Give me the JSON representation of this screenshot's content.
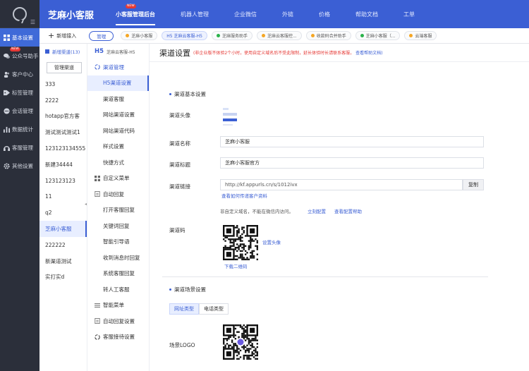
{
  "app": {
    "brand": "芝麻小客服",
    "nav_new_badge": "NEW"
  },
  "topnav": {
    "items": [
      {
        "label": "小客服管理后台",
        "active": true
      },
      {
        "label": "机器人管理"
      },
      {
        "label": "企业微信"
      },
      {
        "label": "外链"
      },
      {
        "label": "价格"
      },
      {
        "label": "帮助文档"
      },
      {
        "label": "工单"
      }
    ]
  },
  "sidebar": {
    "new_badge": "NEW",
    "items": [
      {
        "label": "基本设置",
        "icon": "grid-icon",
        "active": true
      },
      {
        "label": "公众号助手",
        "icon": "wechat-icon"
      },
      {
        "label": "客户中心",
        "icon": "user-group-icon"
      },
      {
        "label": "标签管理",
        "icon": "tag-icon"
      },
      {
        "label": "会话管理",
        "icon": "chat-icon"
      },
      {
        "label": "数据统计",
        "icon": "bar-chart-icon"
      },
      {
        "label": "客服管理",
        "icon": "headset-icon"
      },
      {
        "label": "其他设置",
        "icon": "gear-icon"
      }
    ]
  },
  "tabbar": {
    "add_label": "新增接入",
    "manage_label": "管理",
    "tabs": [
      {
        "label": "芝麻小客服",
        "icon": "moon-icon",
        "color": "#f5a623"
      },
      {
        "label": "H5 芝麻云客服-H5",
        "icon": "h5-icon",
        "color": "#3b5fd4",
        "active": true
      },
      {
        "label": "芝麻服务助手",
        "icon": "wechat-icon",
        "color": "#2ab24a"
      },
      {
        "label": "芝麻云客服控...",
        "icon": "moon-icon",
        "color": "#f5a623"
      },
      {
        "label": "收款码合并助手",
        "icon": "moon-icon",
        "color": "#f5a623"
      },
      {
        "label": "芝麻小客服（...",
        "icon": "wechat-icon",
        "color": "#2ab24a"
      },
      {
        "label": "云端客服",
        "icon": "moon-icon",
        "color": "#f5a623"
      }
    ]
  },
  "channels": {
    "header": "新增渠道(13)",
    "manage_button": "管理渠道",
    "items": [
      {
        "label": "333"
      },
      {
        "label": "2222"
      },
      {
        "label": "hotapp官方客"
      },
      {
        "label": "测试测试测试1"
      },
      {
        "label": "123123134555"
      },
      {
        "label": "新建34444"
      },
      {
        "label": "123123123"
      },
      {
        "label": "11"
      },
      {
        "label": "q2"
      },
      {
        "label": "芝麻小客服",
        "active": true
      },
      {
        "label": "222222"
      },
      {
        "label": "新渠道测试"
      },
      {
        "label": "实打实d"
      }
    ]
  },
  "menu": {
    "header_tag": "H5",
    "header_title": "芝麻云客服-H5",
    "items": [
      {
        "label": "渠道管理",
        "type": "group",
        "icon": "cycle-icon",
        "blue": true
      },
      {
        "label": "H5渠道设置",
        "type": "sub",
        "active": true
      },
      {
        "label": "渠道客服",
        "type": "sub"
      },
      {
        "label": "网站渠道设置",
        "type": "sub"
      },
      {
        "label": "网站渠道代码",
        "type": "sub"
      },
      {
        "label": "样式设置",
        "type": "sub"
      },
      {
        "label": "快捷方式",
        "type": "sub"
      },
      {
        "label": "自定义菜单",
        "type": "group",
        "icon": "grid-icon"
      },
      {
        "label": "自动回复",
        "type": "group",
        "icon": "doc-icon"
      },
      {
        "label": "打开客服回复",
        "type": "sub"
      },
      {
        "label": "关键词回复",
        "type": "sub"
      },
      {
        "label": "智能引导语",
        "type": "sub"
      },
      {
        "label": "收到消息时回复",
        "type": "sub"
      },
      {
        "label": "系统客服回复",
        "type": "sub"
      },
      {
        "label": "转人工客服",
        "type": "sub"
      },
      {
        "label": "智能菜单",
        "type": "group",
        "icon": "list-icon"
      },
      {
        "label": "自动回复设置",
        "type": "group",
        "icon": "doc-icon"
      },
      {
        "label": "客服接待设置",
        "type": "group",
        "icon": "cycle-icon"
      }
    ]
  },
  "main": {
    "title": "渠道设置",
    "hint": "(非企业版不体验2个小时，使用自定义域名后不受此限制，延长体验时长请联系客服，",
    "hint_link": "查看帮助文档)",
    "basic_section": "渠道基本设置",
    "avatar_label": "渠道头像",
    "name_label": "渠道名称",
    "name_value": "芝麻小客服",
    "title_label": "渠道标题",
    "title_value": "芝麻小客服官方",
    "link_label": "渠道链接",
    "link_value": "http://kf.appurls.cn/s/1012ivx",
    "copy_label": "复制",
    "view_link": "查看如何传递客户资料",
    "domain_note": "非自定义域名，不能在微信内访问。",
    "domain_link1": "立刻配置",
    "domain_link2": "查看配置帮助",
    "qr_label": "渠道码",
    "set_avatar": "设置头像",
    "download_qr": "下载二维码",
    "scene_section": "渠道场景设置",
    "scene_tabs": [
      {
        "label": "网址类型",
        "active": true
      },
      {
        "label": "电话类型"
      }
    ],
    "scene_logo_label": "场景LOGO"
  }
}
